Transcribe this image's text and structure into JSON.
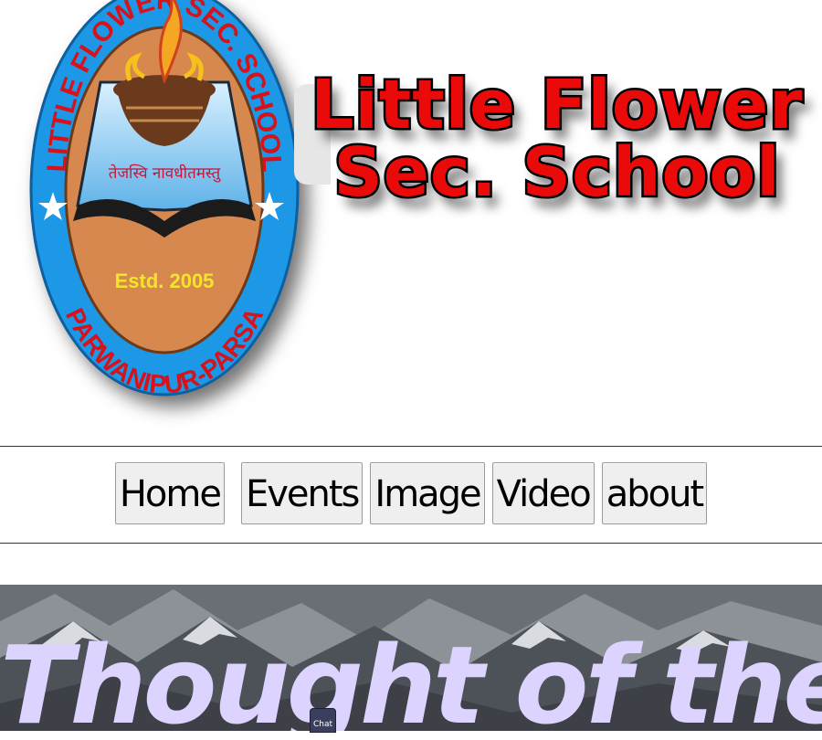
{
  "logo": {
    "ring_top_text": "LITTLE FLOWER SEC. SCHOOL",
    "ring_bottom_text": "PARWANIPUR-PARSA",
    "motto": "तेजस्वि नावधीतमस्तु",
    "established": "Estd. 2005",
    "icon": "school-emblem-icon",
    "colors": {
      "ring": "#1c98e6",
      "inner": "#d7884f",
      "motto": "#c0183a",
      "estd": "#f3e62a",
      "ring_text": "#d6121b"
    }
  },
  "header": {
    "title": "Little Flower Sec. School"
  },
  "nav": {
    "items": [
      {
        "label": "Home"
      },
      {
        "label": "Events"
      },
      {
        "label": "Image"
      },
      {
        "label": "Video"
      },
      {
        "label": "about"
      }
    ]
  },
  "banner": {
    "heading": "Thought of the Day",
    "color": "#ddd3ff"
  },
  "chat": {
    "label": "Chat"
  }
}
